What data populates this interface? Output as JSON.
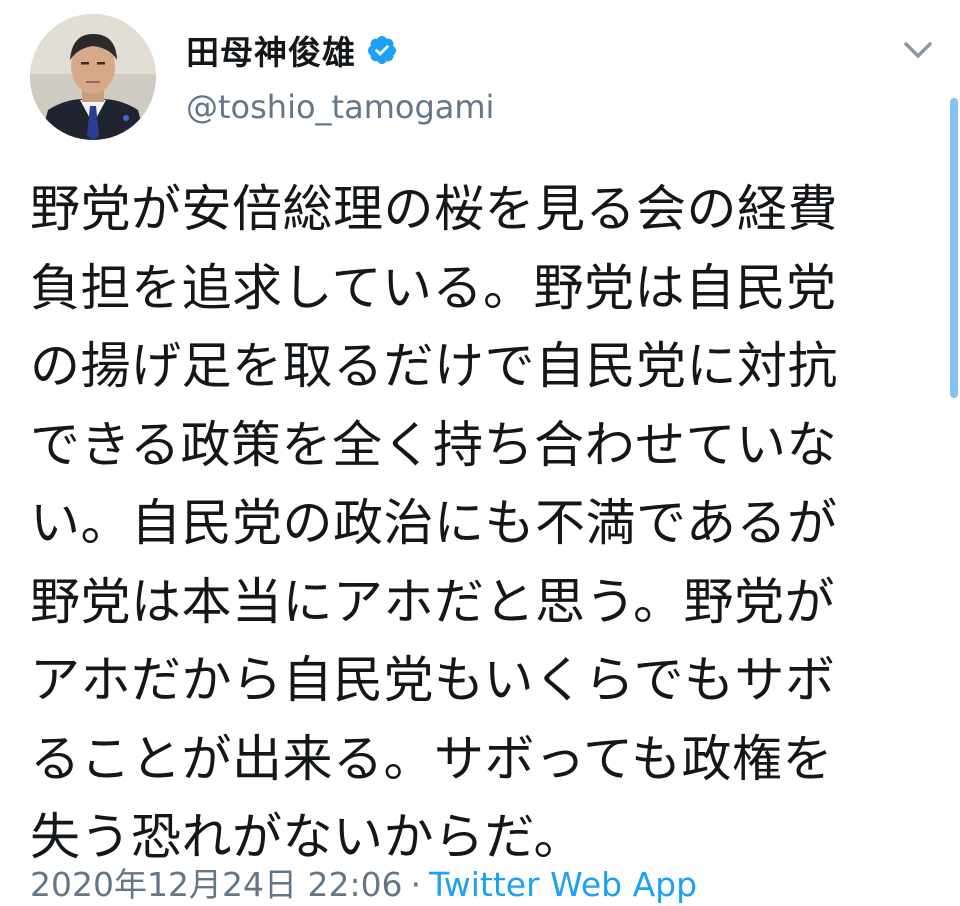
{
  "author": {
    "display_name": "田母神俊雄",
    "handle": "@toshio_tamogami",
    "avatar_icon": "profile-photo-icon",
    "verified_icon": "verified-badge-icon"
  },
  "tweet": {
    "lines": [
      "野党が安倍総理の桜を見る会の経費",
      "負担を追求している。野党は自民党",
      "の揚げ足を取るだけで自民党に対抗",
      "できる政策を全く持ち合わせていな",
      "い。自民党の政治にも不満であるが",
      "野党は本当にアホだと思う。野党が",
      "アホだから自民党もいくらでもサボ",
      "ることが出来る。サボっても政権を",
      "失う恐れがないからだ。"
    ],
    "timestamp": "2020年12月24日 22:06",
    "separator": "·",
    "source": "Twitter Web App"
  },
  "icons": {
    "menu": "chevron-down-icon"
  },
  "colors": {
    "accent": "#1da1f2",
    "secondary_text": "#657786",
    "primary_text": "#14171a",
    "scroll_indicator": "#86c3ee"
  }
}
